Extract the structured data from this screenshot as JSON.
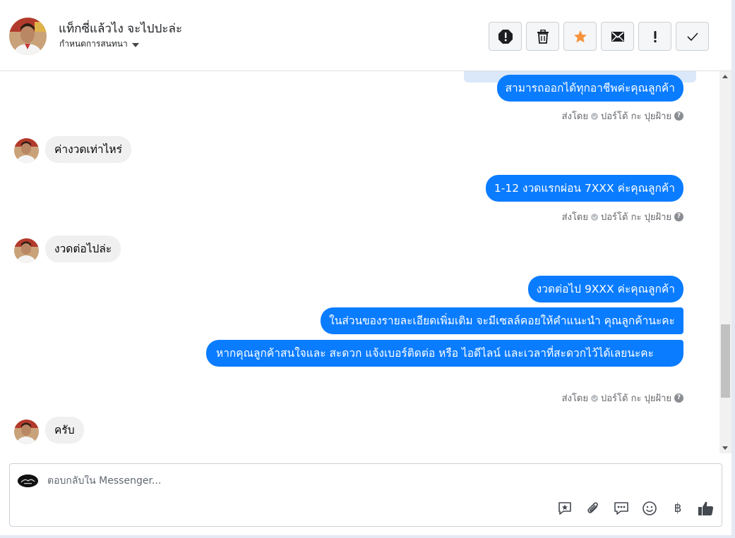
{
  "header": {
    "contact_name": "แท็กซี่แล้วไง จะไปปะล่ะ",
    "assign_label": "กำหนดการสนทนา"
  },
  "toolbar": [
    {
      "name": "spam-button",
      "icon": "alert-circle-icon"
    },
    {
      "name": "delete-button",
      "icon": "trash-icon"
    },
    {
      "name": "star-button",
      "icon": "star-icon"
    },
    {
      "name": "mark-unread-button",
      "icon": "envelope-icon"
    },
    {
      "name": "follow-up-button",
      "icon": "exclamation-icon"
    },
    {
      "name": "mark-done-button",
      "icon": "checkmark-icon"
    }
  ],
  "thread": {
    "messages": {
      "m1": "สามารถออกได้ทุกอาชีพค่ะคุณลูกค้า",
      "m2": "ค่างวดเท่าไหร่",
      "m3": "1-12 งวดแรกผ่อน 7XXX ค่ะคุณลูกค้า",
      "m4": "งวดต่อไปล่ะ",
      "m5": "งวดต่อไป 9XXX ค่ะคุณลูกค้า",
      "m6": "ในส่วนของรายละเอียดเพิ่มเติม จะมีเซลล์คอยให้คำแนะนำ คุณลูกค้านะคะ",
      "m7": "หากคุณลูกค้าสนใจและ สะดวก แจ้งเบอร์ติดต่อ หรือ ไอดีไลน์ และเวลาที่สะดวกไว้ได้เลยนะคะ",
      "m8": "ครับ"
    },
    "sent_by_prefix": "ส่งโดย",
    "sent_by_name": "ปอร์โต้ กะ ปุยฝ้าย",
    "help_glyph": "?"
  },
  "composer": {
    "placeholder": "ตอบกลับใน Messenger...",
    "icons": [
      "saved-reply-icon",
      "attachment-icon",
      "quick-replies-icon",
      "emoji-icon",
      "baht-payment-icon",
      "like-icon"
    ],
    "baht_glyph": "฿"
  },
  "colors": {
    "outgoing_bubble": "#0a7cff",
    "incoming_bubble": "#f0f0f0",
    "star_accent": "#f7923b"
  }
}
